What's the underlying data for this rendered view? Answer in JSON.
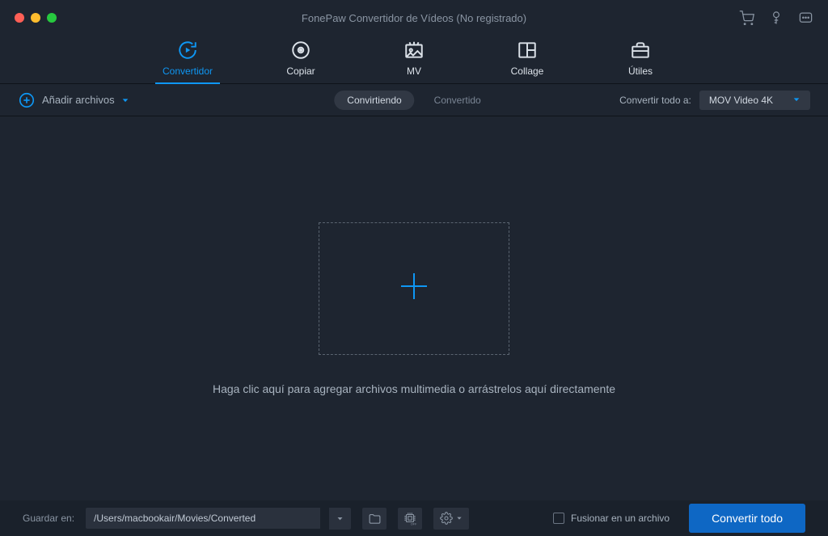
{
  "titlebar": {
    "title": "FonePaw Convertidor de Vídeos (No registrado)"
  },
  "tabs": {
    "convertidor": "Convertidor",
    "copiar": "Copiar",
    "mv": "MV",
    "collage": "Collage",
    "utiles": "Útiles"
  },
  "subbar": {
    "add_files": "Añadir archivos",
    "convirtiendo": "Convirtiendo",
    "convertido": "Convertido",
    "convert_all_label": "Convertir todo a:",
    "format_value": "MOV Video 4K"
  },
  "dropzone": {
    "hint": "Haga clic aquí para agregar archivos multimedia o arrástrelos aquí directamente"
  },
  "bottombar": {
    "save_label": "Guardar en:",
    "path_value": "/Users/macbookair/Movies/Converted",
    "merge_label": "Fusionar en un archivo",
    "convert_btn": "Convertir todo"
  }
}
